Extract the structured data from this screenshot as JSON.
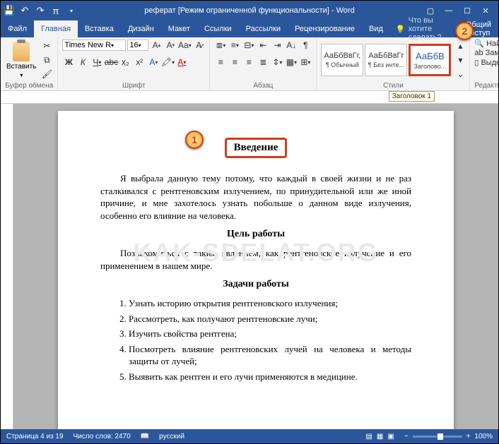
{
  "title": "реферат [Режим ограниченной функциональности] - Word",
  "tabs": {
    "file": "Файл",
    "home": "Главная",
    "insert": "Вставка",
    "design": "Дизайн",
    "layout": "Макет",
    "refs": "Ссылки",
    "mail": "Рассылки",
    "review": "Рецензирование",
    "view": "Вид"
  },
  "tell_me": "Что вы хотите сделать?",
  "share": "Общий доступ",
  "ribbon": {
    "clipboard": {
      "label": "Буфер обмена",
      "paste": "Вставить"
    },
    "font": {
      "label": "Шрифт",
      "name": "Times New R",
      "size": "16"
    },
    "paragraph": {
      "label": "Абзац"
    },
    "styles": {
      "label": "Стили",
      "s1": {
        "preview": "АаБбВвГг,",
        "name": "¶ Обычный"
      },
      "s2": {
        "preview": "АаБбВвГг",
        "name": "¶ Без инте..."
      },
      "s3": {
        "preview": "АаБбВ",
        "name": "Заголово..."
      }
    },
    "editing": {
      "label": "Редактирование",
      "find": "Найти",
      "replace": "Заменить",
      "select": "Выделить"
    }
  },
  "ruler_tooltip": "Заголовок 1",
  "document": {
    "heading": "Введение",
    "para1": "Я выбрала данную тему потому, что каждый в своей жизни и не раз сталкивался с рентгеновским излучением, по принудительной или же иной причине, и мне захотелось узнать побольше о данном виде излучения, особенно его влияние на человека.",
    "sub1": "Цель работы",
    "para2": "Познакомиться с таким явлением, как рентгеновское излучение и его применением в нашем мире.",
    "sub2": "Задачи работы",
    "li1": "Узнать историю открытия рентгеновского излучения;",
    "li2": "Рассмотреть,  как получают рентгеновские лучи;",
    "li3": "Изучить свойства рентгена;",
    "li4": "Посмотреть влияние рентгеновских лучей на человека и методы защиты от лучей;",
    "li5": "Выявить как рентген и его лучи применяются в медицине."
  },
  "watermark": "KAK-SDELAT.ORG",
  "status": {
    "page": "Страница 4 из 19",
    "words": "Число слов: 2470",
    "lang": "русский",
    "zoom": "100%"
  },
  "callouts": {
    "c1": "1",
    "c2": "2"
  }
}
